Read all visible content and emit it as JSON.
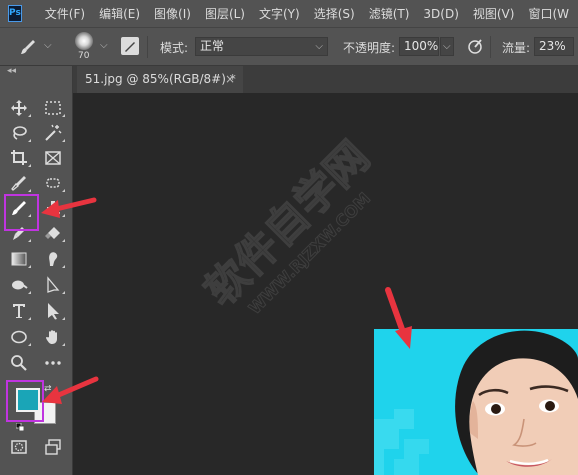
{
  "menubar": {
    "logo": "Ps",
    "items": [
      "文件(F)",
      "编辑(E)",
      "图像(I)",
      "图层(L)",
      "文字(Y)",
      "选择(S)",
      "滤镜(T)",
      "3D(D)",
      "视图(V)",
      "窗口(W"
    ]
  },
  "options": {
    "brush_size": "70",
    "mode_label": "模式:",
    "mode_value": "正常",
    "opacity_label": "不透明度:",
    "opacity_value": "100%",
    "flow_label": "流量:",
    "flow_value": "23%"
  },
  "toolbar": {
    "collapse_glyph": "◂◂"
  },
  "tab": {
    "title": "51.jpg @ 85%(RGB/8#) *",
    "close": "×"
  },
  "watermark": {
    "cn": "软件自学网",
    "en": "WWW.RJZXW.COM"
  },
  "colors": {
    "foreground": "#1aa5b7",
    "background": "#f2f2f2",
    "highlight": "#c034e0",
    "arrow": "#e8343f",
    "photo_bg": "#1fd3ec"
  }
}
